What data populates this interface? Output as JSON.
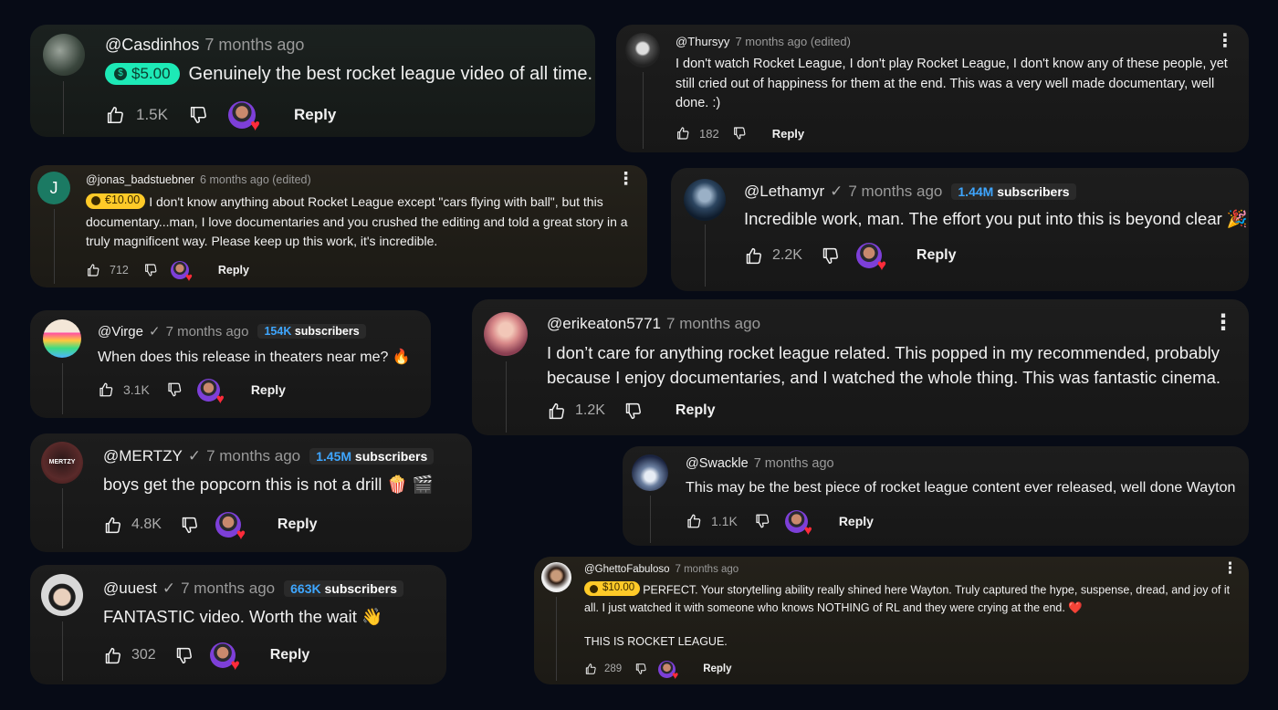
{
  "colors": {
    "page_bg": "#070b16",
    "card_bg": "#181818",
    "sub_count": "#3ea6ff",
    "super_thanks_green": "#1de9b6",
    "super_thanks_gold": "#ffca28",
    "heart": "#ff2b3a"
  },
  "icons": {
    "like": "thumbs-up-icon",
    "dislike": "thumbs-down-icon",
    "heart": "heart-icon",
    "more": "more-vertical-icon",
    "verified": "checkmark-icon",
    "money": "money-icon"
  },
  "comments": [
    {
      "user": "@Casdinhos",
      "time": "7 months ago",
      "amount": "$5.00",
      "text": "Genuinely the best rocket league video of all time.",
      "likes": "1.5K",
      "reply": "Reply"
    },
    {
      "user": "@Thursyy",
      "time": "7 months ago (edited)",
      "text": "I don't watch Rocket League, I don't play Rocket League, I don't know any of these people, yet still cried out of happiness for them at the end. This was a very well made documentary, well done. :)",
      "likes": "182",
      "reply": "Reply"
    },
    {
      "user": "@jonas_badstuebner",
      "time": "6 months ago (edited)",
      "avatar_letter": "J",
      "amount": "€10.00",
      "text": "I don't know anything about Rocket League except \"cars flying with ball\", but this documentary...man, I love documentaries and you crushed the editing and told a great story in a truly magnificent way. Please keep up this work, it's incredible.",
      "likes": "712",
      "reply": "Reply"
    },
    {
      "user": "@Lethamyr",
      "check": "✓",
      "time": "7 months ago",
      "subs_num": "1.44M",
      "subs_word": " subscribers",
      "text": "Incredible work, man. The effort you put into this is beyond clear 🎉",
      "likes": "2.2K",
      "reply": "Reply"
    },
    {
      "user": "@Virge",
      "check": "✓",
      "time": "7 months ago",
      "subs_num": "154K",
      "subs_word": " subscribers",
      "text": "When does this release in theaters near me? 🔥",
      "likes": "3.1K",
      "reply": "Reply"
    },
    {
      "user": "@erikeaton5771",
      "time": "7 months ago",
      "text": "I don’t care for anything rocket league related. This popped in my recommended, probably because I enjoy documentaries, and I watched the whole thing. This was fantastic cinema.",
      "likes": "1.2K",
      "reply": "Reply"
    },
    {
      "user": "@MERTZY",
      "check": "✓",
      "time": "7 months ago",
      "subs_num": "1.45M",
      "subs_word": " subscribers",
      "avatar_text": "MERTZY",
      "text": "boys get the popcorn this is not a drill 🍿 🎬",
      "likes": "4.8K",
      "reply": "Reply"
    },
    {
      "user": "@Swackle",
      "time": "7 months ago",
      "text": "This may be the best piece of rocket league content ever released, well done Wayton",
      "likes": "1.1K",
      "reply": "Reply"
    },
    {
      "user": "@uuest",
      "check": "✓",
      "time": "7 months ago",
      "subs_num": "663K",
      "subs_word": " subscribers",
      "text": "FANTASTIC video. Worth the wait 👋",
      "likes": "302",
      "reply": "Reply"
    },
    {
      "user": "@GhettoFabuloso",
      "time": "7 months ago",
      "amount": "$10.00",
      "text": "PERFECT. Your storytelling ability really shined here Wayton. Truly captured the hype, suspense, dread, and joy of it all.  I just watched it with someone who knows NOTHING of RL and they were crying at the end. ❤️",
      "text2": "THIS IS ROCKET LEAGUE.",
      "likes": "289",
      "reply": "Reply"
    }
  ]
}
